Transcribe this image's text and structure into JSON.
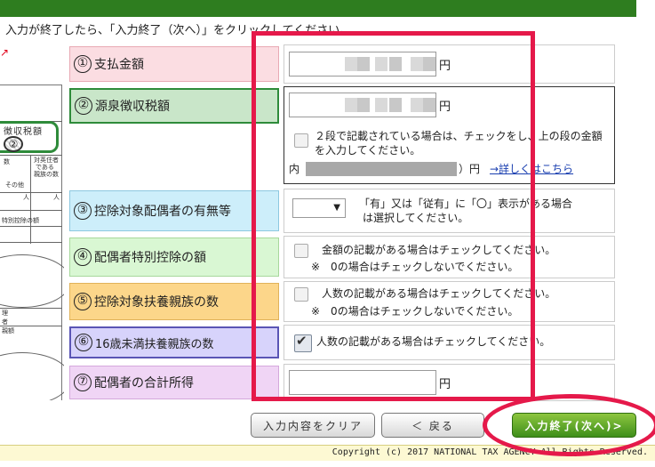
{
  "instruction": "入力が終了したら、「入力終了（次へ）」をクリックしてください。",
  "thumbnail": {
    "box_label": "徴収税額",
    "box_number": "②",
    "small_texts": [
      "数",
      "対英住者",
      "である",
      "親族の数",
      "その他",
      "人",
      "人",
      "特別控除の額",
      "理",
      "者",
      "親額"
    ]
  },
  "rows": [
    {
      "number": "①",
      "label": "支払金額",
      "unit": "円",
      "color": "#fbdde2"
    },
    {
      "number": "②",
      "label": "源泉徴収税額",
      "unit": "円",
      "color": "#c9e6c9",
      "check_note_line1": "２段で記載されている場合は、チェックをし、上の段の金額",
      "check_note_line2": "を入力してください。",
      "inner_prefix": "内（",
      "inner_suffix": "）円",
      "link": "→詳しくはこちら"
    },
    {
      "number": "③",
      "label": "控除対象配偶者の有無等",
      "color": "#cdeefa",
      "select_arrow": "▼",
      "note_line1": "「有」又は「従有」に「〇」表示がある場合",
      "note_line2": "は選択してください。"
    },
    {
      "number": "④",
      "label": "配偶者特別控除の額",
      "color": "#d9f7d3",
      "note_line1": "金額の記載がある場合はチェックしてください。",
      "note_line2": "※　0の場合はチェックしないでください。",
      "checked": false
    },
    {
      "number": "⑤",
      "label": "控除対象扶養親族の数",
      "color": "#fcd68a",
      "note_line1": "人数の記載がある場合はチェックしてください。",
      "note_line2": "※　0の場合はチェックしないでください。",
      "checked": false
    },
    {
      "number": "⑥",
      "label": "16歳未満扶養親族の数",
      "color": "#d7d3fb",
      "note_line1": "人数の記載がある場合はチェックしてください。",
      "checked": true
    },
    {
      "number": "⑦",
      "label": "配偶者の合計所得",
      "unit": "円",
      "color": "#f0d5f5"
    }
  ],
  "buttons": {
    "clear": "入力内容をクリア",
    "back": "＜ 戻る",
    "next": "入力終了(次へ)>"
  },
  "footer": "Copyright (c) 2017 NATIONAL TAX AGENCY All Rights Reserved.",
  "accent_colors": {
    "header_green": "#2e7d1f",
    "annotation_red": "#e5194a",
    "next_green": "#3e8e1a"
  }
}
